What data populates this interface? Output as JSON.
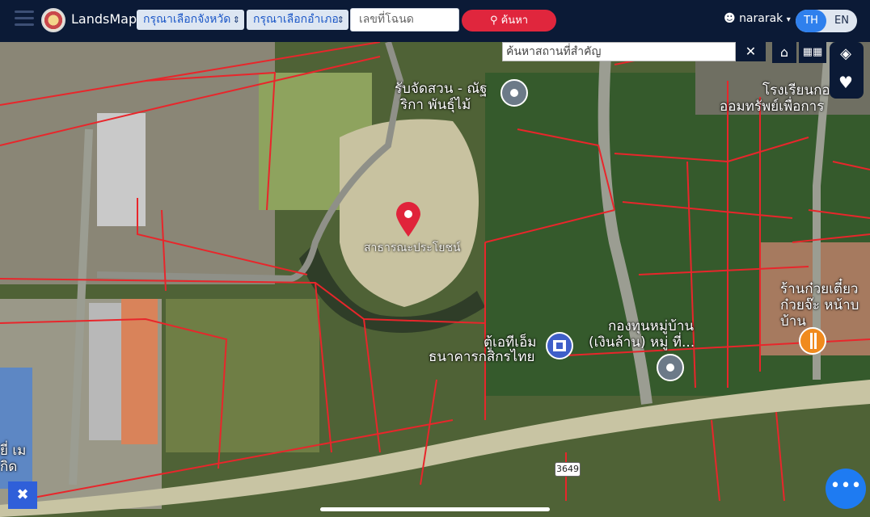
{
  "app": {
    "title": "LandsMaps"
  },
  "header": {
    "province_select": "กรุณาเลือกจังหวัด",
    "district_select": "กรุณาเลือกอำเภอ",
    "deed_placeholder": "เลขที่โฉนด",
    "search_button": "ค้นหา",
    "username": "nararak",
    "lang_th": "TH",
    "lang_en": "EN"
  },
  "map": {
    "poi_search_placeholder": "ค้นหาสถานที่สำคัญ",
    "close_label": "✕",
    "road_badge": "3649",
    "labels": [
      {
        "text": "รับจัดสวน - ณัฐ"
      },
      {
        "text": "ริกา พันธุ์ไม้"
      },
      {
        "text": "โรงเรียนกอ"
      },
      {
        "text": "ออมทรัพย์เพื่อการ"
      },
      {
        "text": "สาธารณะประโยชน์"
      },
      {
        "text": "ตู้เอทีเอ็ม"
      },
      {
        "text": "ธนาคารกสิกรไทย"
      },
      {
        "text": "กองทุนหมู่บ้าน"
      },
      {
        "text": "(เงินล้าน) หมู่ ที่..."
      },
      {
        "text": "ร้านก๋วยเตี๋ยว"
      },
      {
        "text": "ก๋วยจ๊ะ หน้าบ"
      },
      {
        "text": "บ้าน"
      },
      {
        "text": "ยี่ เม"
      },
      {
        "text": "กิด"
      }
    ]
  },
  "colors": {
    "topbar": "#0b1a36",
    "accent": "#2f80ed",
    "search": "#e0263d",
    "parcel": "#e8262b"
  },
  "icons": [
    "menu-icon",
    "search-icon",
    "user-icon",
    "home-icon",
    "grid-icon",
    "layers-icon",
    "heart-icon",
    "more-icon",
    "measure-icon",
    "map-pin-icon",
    "bank-icon",
    "restaurant-icon"
  ]
}
